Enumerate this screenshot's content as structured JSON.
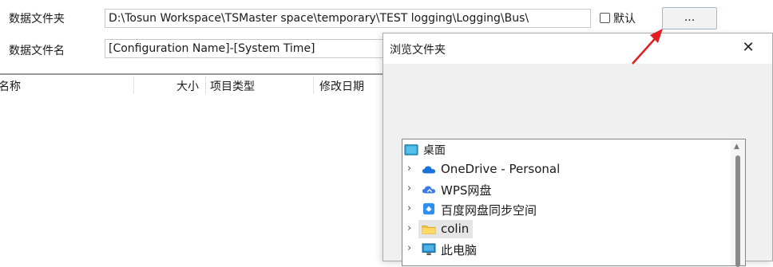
{
  "form": {
    "data_folder_label": "数据文件夹",
    "data_folder_value": "D:\\Tosun Workspace\\TSMaster space\\temporary\\TEST logging\\Logging\\Bus\\",
    "default_label": "默认",
    "browse_label": "...",
    "data_file_name_label": "数据文件名",
    "data_file_name_value": "[Configuration Name]-[System Time]"
  },
  "list_headers": {
    "name": "名称",
    "size": "大小",
    "type": "项目类型",
    "modified": "修改日期"
  },
  "dialog": {
    "title": "浏览文件夹",
    "close": "✕",
    "tree": [
      {
        "label": "桌面",
        "icon": "desktop-icon"
      },
      {
        "label": "OneDrive - Personal",
        "icon": "onedrive-cloud-icon"
      },
      {
        "label": "WPS网盘",
        "icon": "wps-cloud-icon"
      },
      {
        "label": "百度网盘同步空间",
        "icon": "baidu-sync-icon"
      },
      {
        "label": "colin",
        "icon": "folder-icon"
      },
      {
        "label": "此电脑",
        "icon": "computer-icon"
      }
    ]
  },
  "colors": {
    "annotation_arrow": "#e02020",
    "button_border": "#9fb9d6",
    "selection": "#e5e5e5"
  }
}
